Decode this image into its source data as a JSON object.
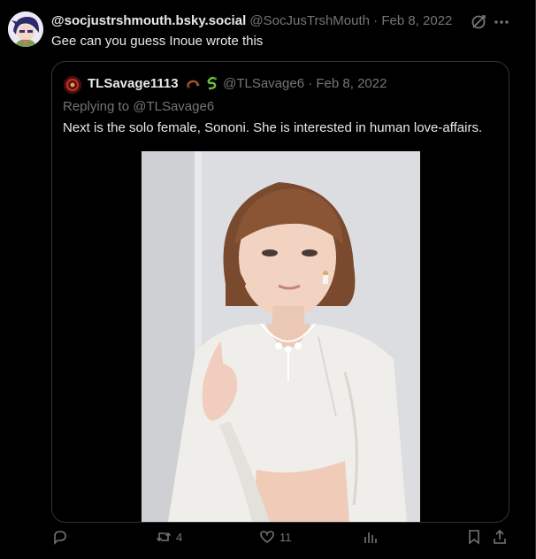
{
  "tweet": {
    "display_name": "@socjustrshmouth.bsky.social",
    "handle": "@SocJusTrshMouth",
    "separator": "·",
    "date": "Feb 8, 2022",
    "text": "Gee can you guess Inoue wrote this"
  },
  "quote": {
    "display_name": "TLSavage1113",
    "handle": "@TLSavage6",
    "separator": "·",
    "date": "Feb 8, 2022",
    "replying_prefix": "Replying to",
    "replying_handle": "@TLSavage6",
    "text": "Next is the solo female, Sononi. She is interested in human love-affairs."
  },
  "actions": {
    "retweets": "4",
    "likes": "11"
  },
  "colors": {
    "background": "#000000",
    "text": "#e7e9ea",
    "muted": "#71767b",
    "border": "#2f3336"
  }
}
